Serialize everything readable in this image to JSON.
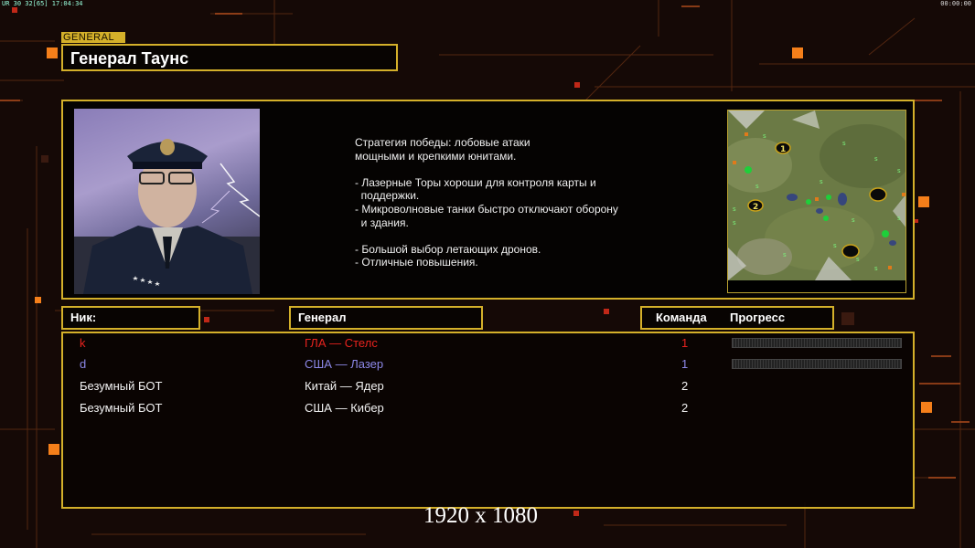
{
  "hud": {
    "top_left": "UR 30 32[65] 17:04:34",
    "top_right": "00:00:00"
  },
  "general": {
    "tag": "GENERAL",
    "name": "Генерал Таунс",
    "portrait_icon": "general-portrait",
    "description": [
      "Стратегия победы: лобовые атаки",
      "мощными и крепкими юнитами.",
      "",
      "- Лазерные Торы хороши для контроля карты и",
      "  поддержки.",
      "- Микроволновые танки быстро отключают оборону",
      "  и здания.",
      "",
      "- Большой выбор летающих дронов.",
      "- Отличные повышения."
    ],
    "minimap_markers": [
      "1",
      "2"
    ]
  },
  "table": {
    "headers": {
      "nick": "Ник:",
      "general": "Генерал",
      "team": "Команда",
      "progress": "Прогресс"
    },
    "rows": [
      {
        "nick": "k",
        "general": "ГЛА — Стелс",
        "team": "1",
        "color": "#e8231e",
        "progress": 0
      },
      {
        "nick": "d",
        "general": "США — Лазер",
        "team": "1",
        "color": "#8c88e8",
        "progress": 0
      },
      {
        "nick": "Безумный БОТ",
        "general": "Китай — Ядер",
        "team": "2",
        "color": "#f2f2f2"
      },
      {
        "nick": "Безумный БОТ",
        "general": "США — Кибер",
        "team": "2",
        "color": "#f2f2f2"
      }
    ]
  },
  "resolution_label": "1920 x 1080",
  "colors": {
    "frame": "#d4b02a",
    "accent_orange": "#f57f1a",
    "background": "#150906"
  }
}
